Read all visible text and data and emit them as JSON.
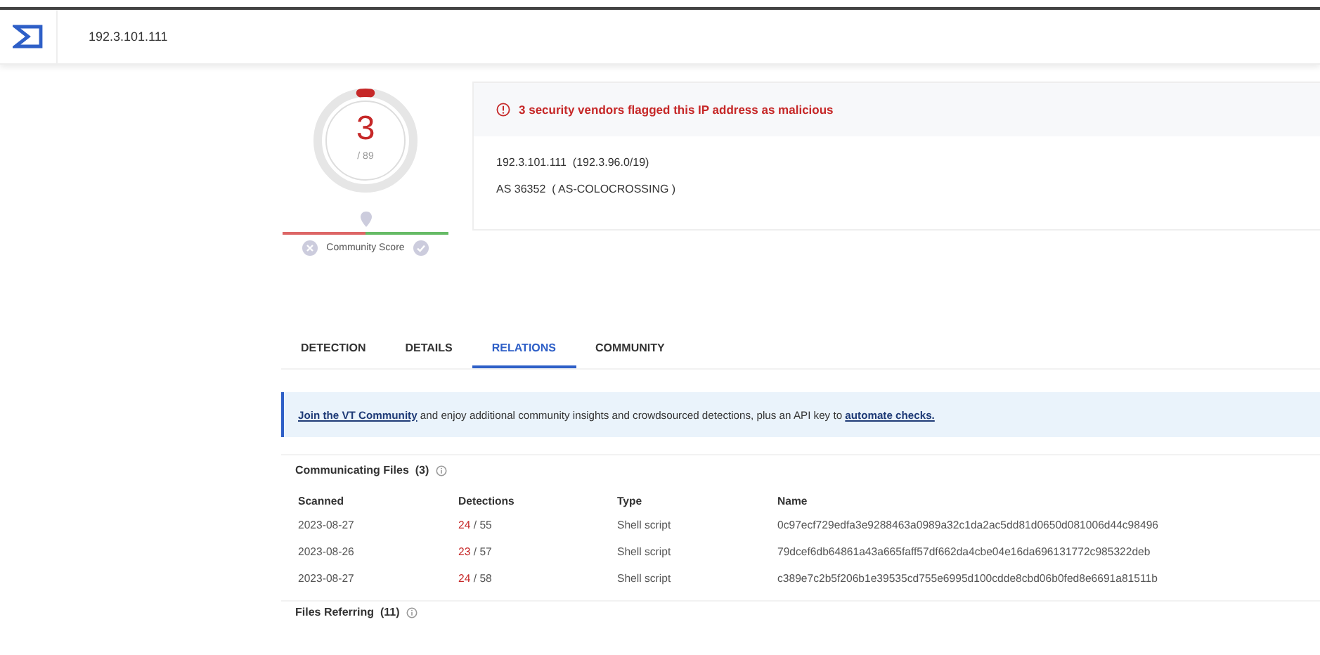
{
  "header": {
    "search_value": "192.3.101.111"
  },
  "score": {
    "value": "3",
    "total": "/ 89",
    "community_label": "Community Score"
  },
  "summary": {
    "alert": "3 security vendors flagged this IP address as malicious",
    "lines": [
      "192.3.101.111  (192.3.96.0/19)",
      "AS 36352  ( AS-COLOCROSSING )"
    ]
  },
  "tabs": [
    {
      "label": "DETECTION",
      "selected": false
    },
    {
      "label": "DETAILS",
      "selected": false
    },
    {
      "label": "RELATIONS",
      "selected": true
    },
    {
      "label": "COMMUNITY",
      "selected": false
    }
  ],
  "banner": {
    "link": "Join the VT Community",
    "text": " and enjoy additional community insights and crowdsourced detections, plus an API key to ",
    "link2": "automate checks."
  },
  "communicating_files": {
    "title": "Communicating Files  (3)",
    "columns": [
      "Scanned",
      "Detections",
      "Type",
      "Name"
    ],
    "rows": [
      {
        "scanned": "2023-08-27",
        "flagged": "24",
        "total": "/ 55",
        "type": "Shell script",
        "name": "0c97ecf729edfa3e9288463a0989a32c1da2ac5dd81d0650d081006d44c98496"
      },
      {
        "scanned": "2023-08-26",
        "flagged": "23",
        "total": "/ 57",
        "type": "Shell script",
        "name": "79dcef6db64861a43a665faff57df662da4cbe04e16da696131772c985322deb"
      },
      {
        "scanned": "2023-08-27",
        "flagged": "24",
        "total": "/ 58",
        "type": "Shell script",
        "name": "c389e7c2b5f206b1e39535cd755e6995d100cdde8cbd06b0fed8e6691a81511b"
      }
    ]
  },
  "files_referring": {
    "title": "Files Referring  (11)"
  }
}
